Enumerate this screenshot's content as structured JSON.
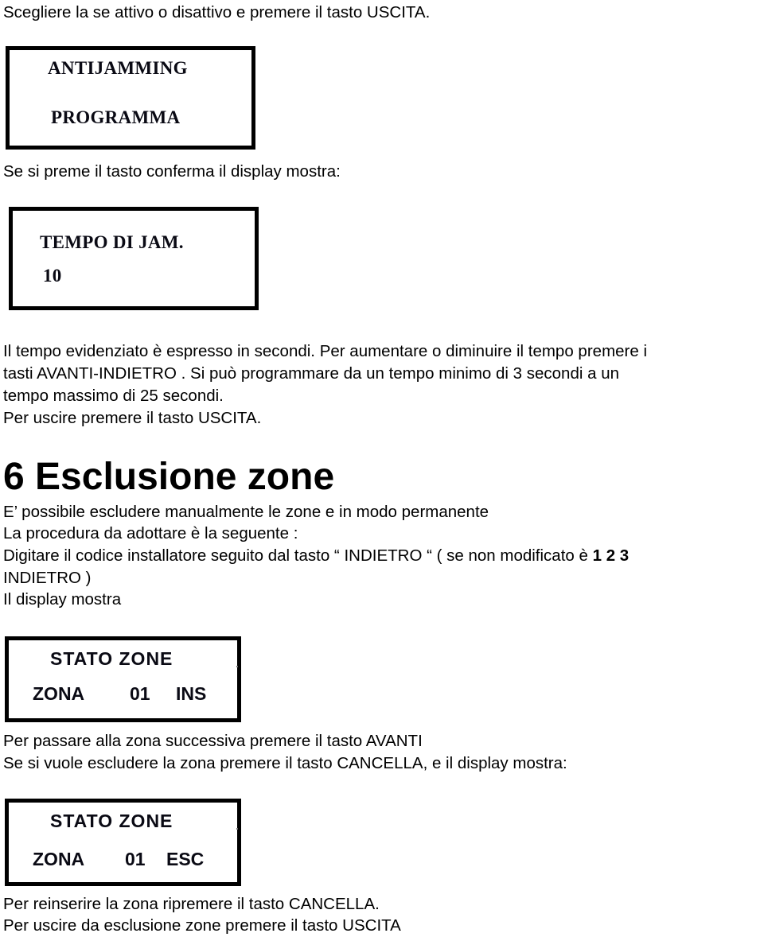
{
  "document": {
    "intro_line": "Scegliere la se attivo o disattivo e premere il tasto USCITA.",
    "display_antijamming": {
      "line1": "ANTIJAMMING",
      "line2": "PROGRAMMA"
    },
    "confirm_line": "Se si preme il tasto conferma il display mostra:",
    "display_tempo": {
      "line1": "TEMPO DI JAM.",
      "line2": "10"
    },
    "tempo_paragraph": [
      "Il tempo evidenziato è espresso in secondi. Per aumentare o diminuire il tempo premere i",
      "tasti AVANTI-INDIETRO . Si può programmare da un tempo minimo di 3 secondi a un",
      "tempo massimo di 25 secondi.",
      "Per uscire premere il tasto USCITA."
    ],
    "section": {
      "heading": "6 Esclusione zone",
      "lines": [
        "E’ possibile escludere manualmente le zone e in modo permanente",
        "La procedura da adottare è la seguente :"
      ],
      "code_line": {
        "text": "Digitare il codice installatore seguito dal tasto “ INDIETRO “ ( se non modificato è ",
        "bold": "1 2 3",
        "continuation": "INDIETRO )"
      },
      "display_line": "Il display mostra"
    },
    "display_stato_ins": {
      "title": "STATO ZONE",
      "label": "ZONA",
      "number": "01",
      "status": "INS"
    },
    "after_ins": [
      "Per passare alla zona successiva premere il tasto AVANTI",
      "Se si vuole escludere la zona premere il tasto CANCELLA, e il display mostra:"
    ],
    "display_stato_esc": {
      "title": "STATO ZONE",
      "label": "ZONA",
      "number": "01",
      "status": "ESC"
    },
    "closing": [
      "Per reinserire la zona ripremere il tasto CANCELLA.",
      "Per uscire da esclusione zone premere il tasto USCITA"
    ]
  }
}
